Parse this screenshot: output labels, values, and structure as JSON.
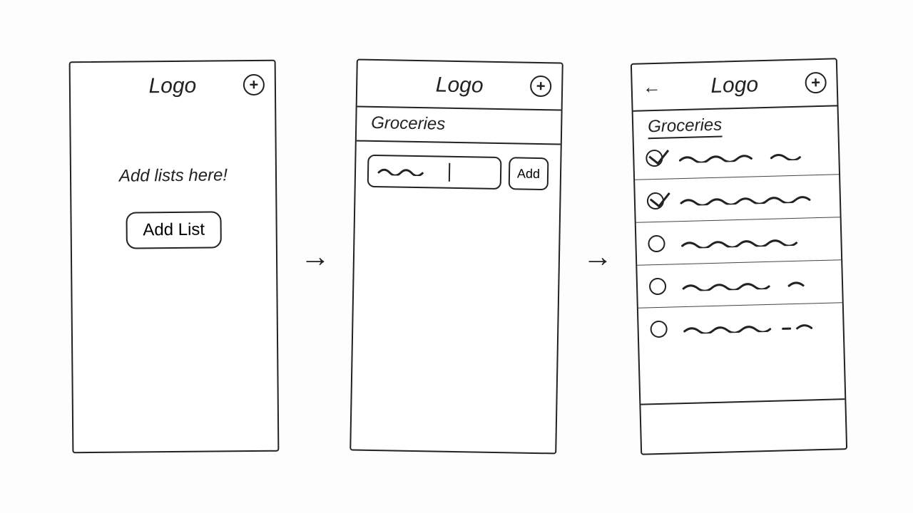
{
  "logo_text": "Logo",
  "plus_label": "+",
  "screen1": {
    "prompt": "Add lists here!",
    "button": "Add List"
  },
  "screen2": {
    "title": "Groceries",
    "add_button": "Add"
  },
  "screen3": {
    "title": "Groceries",
    "items": [
      {
        "checked": true
      },
      {
        "checked": true
      },
      {
        "checked": false
      },
      {
        "checked": false
      },
      {
        "checked": false
      }
    ]
  },
  "arrows": {
    "forward": "→",
    "back": "←"
  }
}
